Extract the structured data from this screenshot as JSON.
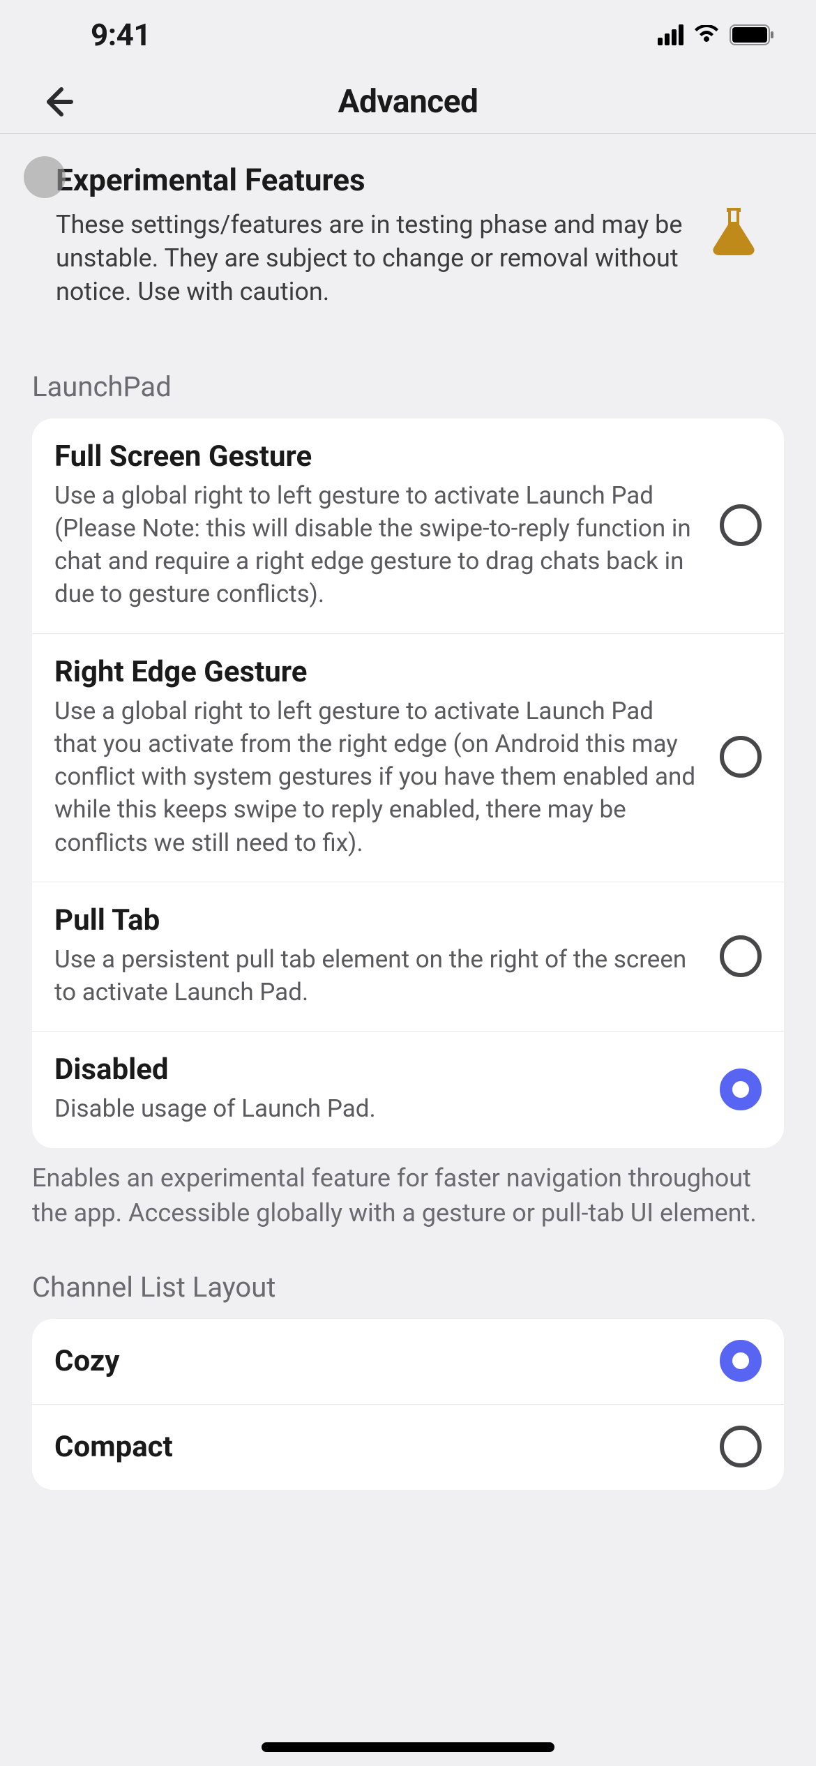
{
  "status": {
    "time": "9:41"
  },
  "header": {
    "title": "Advanced"
  },
  "experimental": {
    "title": "Experimental Features",
    "description": "These settings/features are in testing phase and may be unstable. They are subject to change or removal without notice. Use with caution."
  },
  "sections": {
    "launchpad": {
      "label": "LaunchPad",
      "options": [
        {
          "title": "Full Screen Gesture",
          "description": "Use a global right to left gesture to activate Launch Pad (Please Note: this will disable the swipe-to-reply function in chat and require a right edge gesture to drag chats back in due to gesture conflicts).",
          "selected": false
        },
        {
          "title": "Right Edge Gesture",
          "description": "Use a global right to left gesture to activate Launch Pad that you activate from the right edge (on Android this may conflict with system gestures if you have them enabled and while this keeps swipe to reply enabled, there may be conflicts we still need to fix).",
          "selected": false
        },
        {
          "title": "Pull Tab",
          "description": "Use a persistent pull tab element on the right of the screen to activate Launch Pad.",
          "selected": false
        },
        {
          "title": "Disabled",
          "description": "Disable usage of Launch Pad.",
          "selected": true
        }
      ],
      "footer": "Enables an experimental feature for faster navigation throughout the app. Accessible globally with a gesture or pull-tab UI element."
    },
    "channel_layout": {
      "label": "Channel List Layout",
      "options": [
        {
          "title": "Cozy",
          "selected": true
        },
        {
          "title": "Compact",
          "selected": false
        }
      ]
    }
  }
}
